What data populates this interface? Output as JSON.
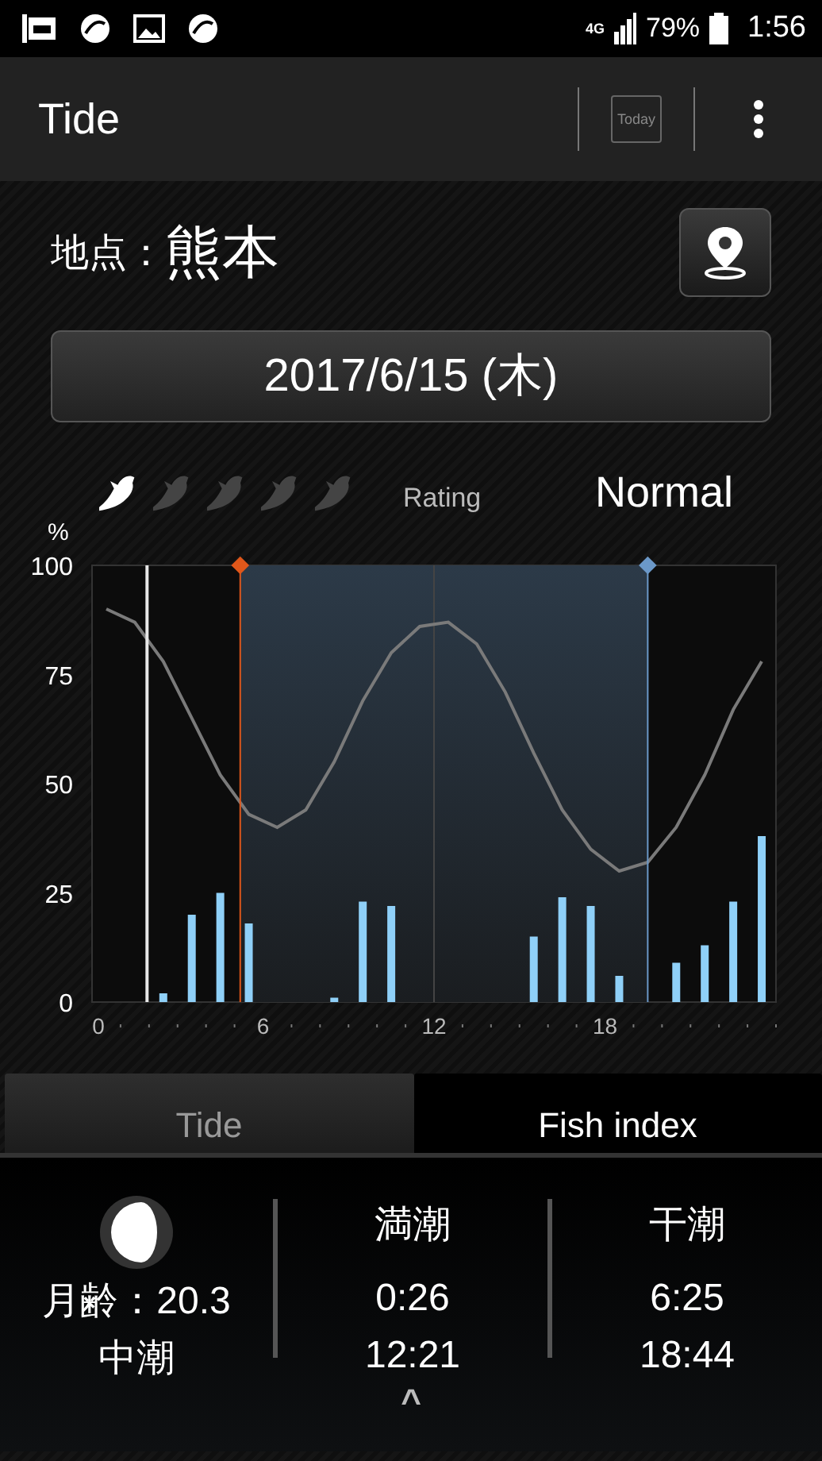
{
  "status_bar": {
    "battery_text": "79%",
    "network": "4G",
    "time": "1:56"
  },
  "app_bar": {
    "title": "Tide",
    "today_button": "Today"
  },
  "location": {
    "label": "地点：",
    "name": "熊本"
  },
  "date": "2017/6/15 (木)",
  "rating": {
    "stars": 1,
    "label": "Rating",
    "value": "Normal"
  },
  "chart": {
    "unit": "%",
    "chart_data": {
      "type": "bar",
      "x": [
        0.5,
        1.5,
        2.5,
        3.5,
        4.5,
        5.5,
        6.5,
        7.5,
        8.5,
        9.5,
        10.5,
        11.5,
        12.5,
        13.5,
        14.5,
        15.5,
        16.5,
        17.5,
        18.5,
        19.5,
        20.5,
        21.5,
        22.5,
        23.5
      ],
      "xlim": [
        0,
        24
      ],
      "ylim": [
        0,
        100
      ],
      "xticks": [
        0,
        6,
        12,
        18
      ],
      "yticks": [
        0,
        25,
        50,
        75,
        100
      ],
      "series": [
        {
          "type": "bar",
          "color": "#8fd0f8",
          "values": [
            null,
            null,
            2,
            20,
            25,
            18,
            null,
            null,
            1,
            23,
            22,
            null,
            null,
            null,
            null,
            15,
            24,
            22,
            6,
            null,
            9,
            13,
            23,
            38
          ]
        },
        {
          "type": "line",
          "color": "#7a7a7a",
          "values": [
            90,
            87,
            78,
            65,
            52,
            43,
            40,
            44,
            55,
            69,
            80,
            86,
            87,
            82,
            71,
            57,
            44,
            35,
            30,
            32,
            40,
            52,
            67,
            78
          ]
        }
      ],
      "ref_lines": [
        {
          "axis": "x",
          "value": 1.93,
          "color": "#e8e8e8"
        },
        {
          "axis": "x",
          "value": 5.2,
          "color": "#e0571a"
        },
        {
          "axis": "x",
          "value": 19.5,
          "color": "#6b98c8"
        }
      ],
      "bands": [
        {
          "axis": "x",
          "from": 5.2,
          "to": 19.5,
          "color": "#2c3a48"
        }
      ]
    }
  },
  "tabs": [
    {
      "label": "Tide",
      "selected": false
    },
    {
      "label": "Fish index",
      "selected": true
    }
  ],
  "summary": {
    "moon_age": "月齢：20.3",
    "tide_name": "中潮",
    "high_tide": {
      "label": "満潮",
      "times": [
        "0:26",
        "12:21"
      ]
    },
    "low_tide": {
      "label": "干潮",
      "times": [
        "6:25",
        "18:44"
      ]
    },
    "expand": "^"
  }
}
